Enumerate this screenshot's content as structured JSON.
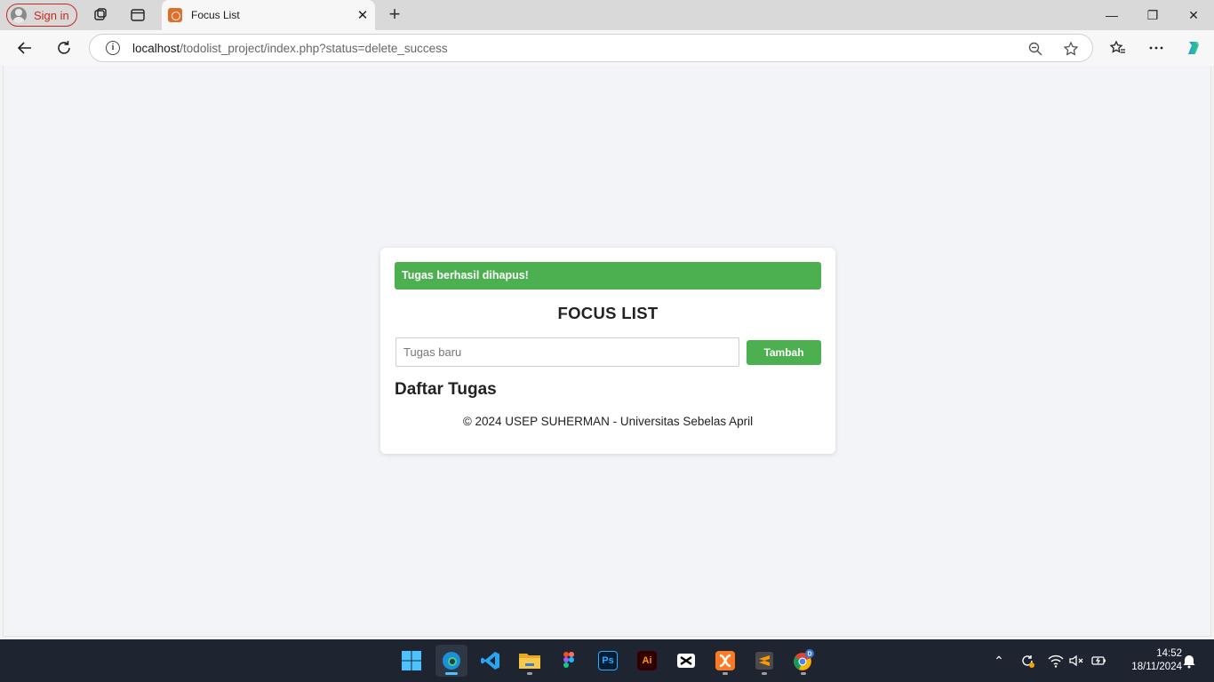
{
  "browser": {
    "signin_label": "Sign in",
    "tab_title": "Focus List",
    "url_host": "localhost",
    "url_path": "/todolist_project/index.php?status=delete_success"
  },
  "page": {
    "alert_text": "Tugas berhasil dihapus!",
    "title": "FOCUS LIST",
    "input_placeholder": "Tugas baru",
    "add_button": "Tambah",
    "list_heading": "Daftar Tugas",
    "footer": "© 2024 USEP SUHERMAN - Universitas Sebelas April"
  },
  "taskbar": {
    "time": "14:52",
    "date": "18/11/2024",
    "apps": [
      "start-icon",
      "edge-icon",
      "vscode-icon",
      "file-explorer-icon",
      "figma-icon",
      "photoshop-icon",
      "illustrator-icon",
      "capcut-icon",
      "xampp-icon",
      "sublime-icon",
      "chrome-icon"
    ]
  },
  "colors": {
    "accent_green": "#4caf50",
    "signin_red": "#c42b1c",
    "taskbar_bg": "#1f2530"
  }
}
